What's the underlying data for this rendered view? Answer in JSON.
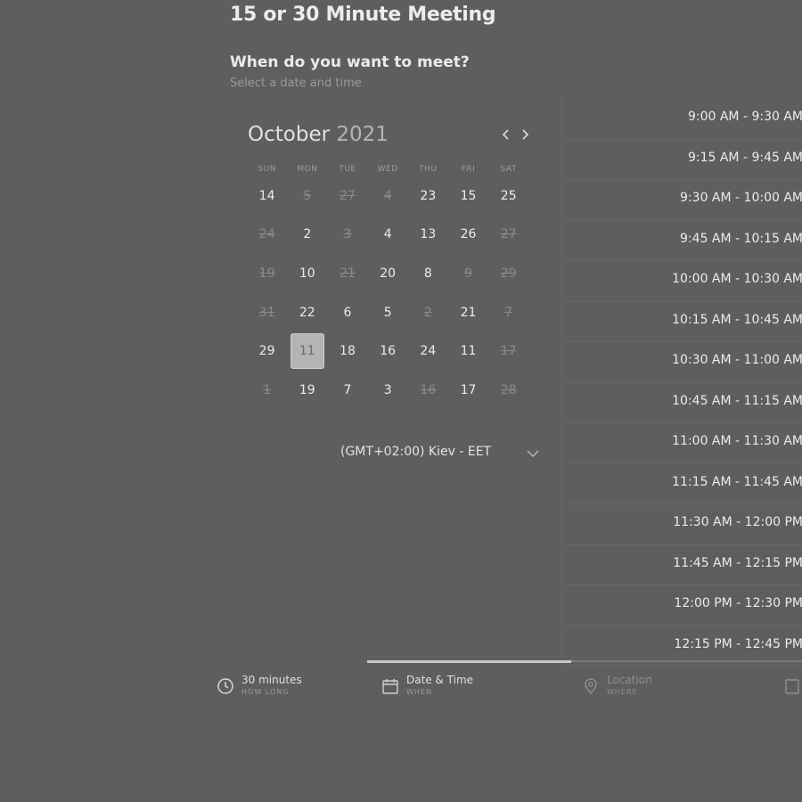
{
  "header": {
    "title": "15 or 30 Minute Meeting",
    "subtitle": "When do you want to meet?",
    "helper": "Select a date and time"
  },
  "calendar": {
    "month": "October",
    "year": "2021",
    "weekdays": [
      "SUN",
      "MON",
      "TUE",
      "WED",
      "THU",
      "FRI",
      "SAT"
    ],
    "days": [
      {
        "label": "14",
        "available": true,
        "selected": false
      },
      {
        "label": "5",
        "available": false,
        "selected": false
      },
      {
        "label": "27",
        "available": false,
        "selected": false
      },
      {
        "label": "4",
        "available": false,
        "selected": false
      },
      {
        "label": "23",
        "available": true,
        "selected": false
      },
      {
        "label": "15",
        "available": true,
        "selected": false
      },
      {
        "label": "25",
        "available": true,
        "selected": false
      },
      {
        "label": "24",
        "available": false,
        "selected": false
      },
      {
        "label": "2",
        "available": true,
        "selected": false
      },
      {
        "label": "3",
        "available": false,
        "selected": false
      },
      {
        "label": "4",
        "available": true,
        "selected": false
      },
      {
        "label": "13",
        "available": true,
        "selected": false
      },
      {
        "label": "26",
        "available": true,
        "selected": false
      },
      {
        "label": "27",
        "available": false,
        "selected": false
      },
      {
        "label": "19",
        "available": false,
        "selected": false
      },
      {
        "label": "10",
        "available": true,
        "selected": false
      },
      {
        "label": "21",
        "available": false,
        "selected": false
      },
      {
        "label": "20",
        "available": true,
        "selected": false
      },
      {
        "label": "8",
        "available": true,
        "selected": false
      },
      {
        "label": "9",
        "available": false,
        "selected": false
      },
      {
        "label": "29",
        "available": false,
        "selected": false
      },
      {
        "label": "31",
        "available": false,
        "selected": false
      },
      {
        "label": "22",
        "available": true,
        "selected": false
      },
      {
        "label": "6",
        "available": true,
        "selected": false
      },
      {
        "label": "5",
        "available": true,
        "selected": false
      },
      {
        "label": "2",
        "available": false,
        "selected": false
      },
      {
        "label": "21",
        "available": true,
        "selected": false
      },
      {
        "label": "7",
        "available": false,
        "selected": false
      },
      {
        "label": "29",
        "available": true,
        "selected": false
      },
      {
        "label": "11",
        "available": true,
        "selected": true
      },
      {
        "label": "18",
        "available": true,
        "selected": false
      },
      {
        "label": "16",
        "available": true,
        "selected": false
      },
      {
        "label": "24",
        "available": true,
        "selected": false
      },
      {
        "label": "11",
        "available": true,
        "selected": false
      },
      {
        "label": "17",
        "available": false,
        "selected": false
      },
      {
        "label": "1",
        "available": false,
        "selected": false
      },
      {
        "label": "19",
        "available": true,
        "selected": false
      },
      {
        "label": "7",
        "available": true,
        "selected": false
      },
      {
        "label": "3",
        "available": true,
        "selected": false
      },
      {
        "label": "16",
        "available": false,
        "selected": false
      },
      {
        "label": "17",
        "available": true,
        "selected": false
      },
      {
        "label": "28",
        "available": false,
        "selected": false
      }
    ]
  },
  "timezone": {
    "value": "(GMT+02:00) Kiev - EET",
    "icon": "chevron-down-icon"
  },
  "slots": [
    "9:00 AM - 9:30 AM",
    "9:15 AM - 9:45 AM",
    "9:30 AM - 10:00 AM",
    "9:45 AM - 10:15 AM",
    "10:00 AM - 10:30 AM",
    "10:15 AM - 10:45 AM",
    "10:30 AM - 11:00 AM",
    "10:45 AM - 11:15 AM",
    "11:00 AM - 11:30 AM",
    "11:15 AM - 11:45 AM",
    "11:30 AM - 12:00 PM",
    "11:45 AM - 12:15 PM",
    "12:00 PM - 12:30 PM",
    "12:15 PM - 12:45 PM"
  ],
  "steps": [
    {
      "label": "30 minutes",
      "sub": "HOW LONG",
      "icon": "clock-icon",
      "active": true
    },
    {
      "label": "Date & Time",
      "sub": "WHEN",
      "icon": "calendar-icon",
      "active": true
    },
    {
      "label": "Location",
      "sub": "WHERE",
      "icon": "location-icon",
      "active": false
    }
  ],
  "progress": {
    "fraction": 0.47
  },
  "colors": {
    "background": "#5e5e5e",
    "selected_day": "#b4b4b4",
    "text": "#ececec"
  }
}
